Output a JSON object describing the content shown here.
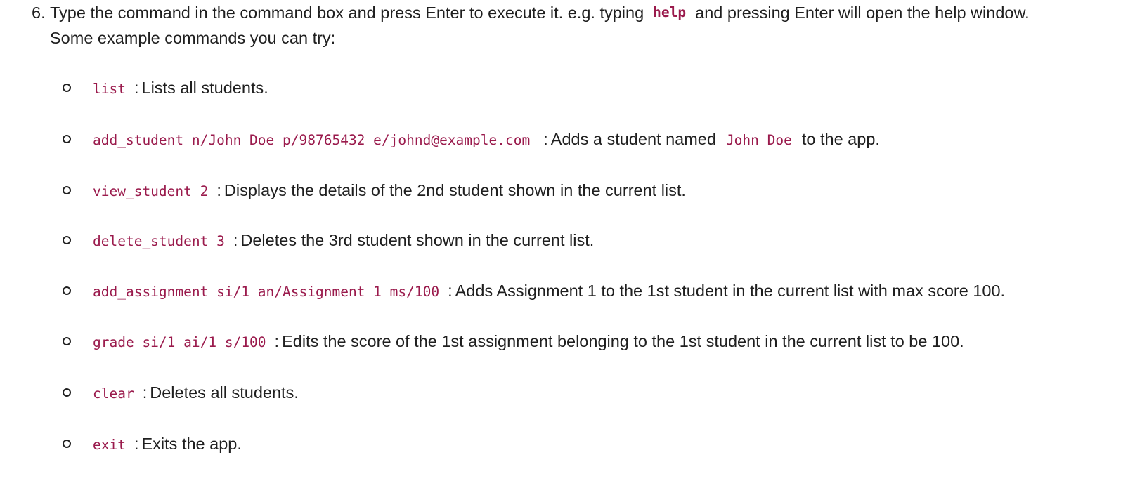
{
  "step": {
    "number": "6.",
    "line1_before": "Type the command in the command box and press Enter to execute it. e.g. typing",
    "line1_code": "help",
    "line1_after": "and pressing Enter will open the help window.",
    "line2": "Some example commands you can try:"
  },
  "commands": [
    {
      "code": "list",
      "separator": ":",
      "desc": "Lists all students."
    },
    {
      "code": "add_student n/John Doe p/98765432 e/johnd@example.com",
      "separator": ":",
      "desc_before": "Adds a student named",
      "desc_code": "John Doe",
      "desc_after": "to the app."
    },
    {
      "code": "view_student 2",
      "separator": ":",
      "desc": "Displays the details of the 2nd student shown in the current list."
    },
    {
      "code": "delete_student 3",
      "separator": ":",
      "desc": "Deletes the 3rd student shown in the current list."
    },
    {
      "code": "add_assignment si/1 an/Assignment 1 ms/100",
      "separator": ":",
      "desc": "Adds Assignment 1 to the 1st student in the current list with max score 100."
    },
    {
      "code": "grade si/1 ai/1 s/100",
      "separator": ":",
      "desc": "Edits the score of the 1st assignment belonging to the 1st student in the current list to be 100."
    },
    {
      "code": "clear",
      "separator": ":",
      "desc": "Deletes all students."
    },
    {
      "code": "exit",
      "separator": ":",
      "desc": "Exits the app."
    }
  ]
}
